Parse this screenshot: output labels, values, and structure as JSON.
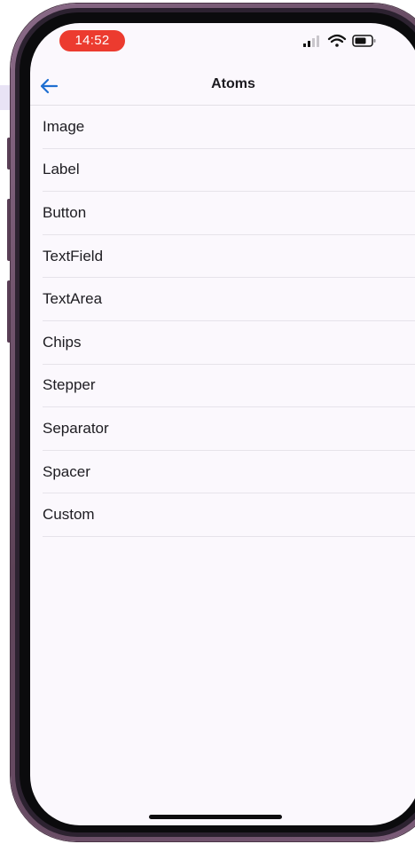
{
  "status_bar": {
    "time": "14:52"
  },
  "nav": {
    "back_icon": "arrow-left-icon",
    "title": "Atoms"
  },
  "list": {
    "items": [
      {
        "label": "Image"
      },
      {
        "label": "Label"
      },
      {
        "label": "Button"
      },
      {
        "label": "TextField"
      },
      {
        "label": "TextArea"
      },
      {
        "label": "Chips"
      },
      {
        "label": "Stepper"
      },
      {
        "label": "Separator"
      },
      {
        "label": "Spacer"
      },
      {
        "label": "Custom"
      }
    ]
  },
  "colors": {
    "time_pill": "#ec3b2f",
    "accent": "#1f6fd1",
    "screen_background": "#fbf8fd",
    "frame": "#6b4f68"
  }
}
